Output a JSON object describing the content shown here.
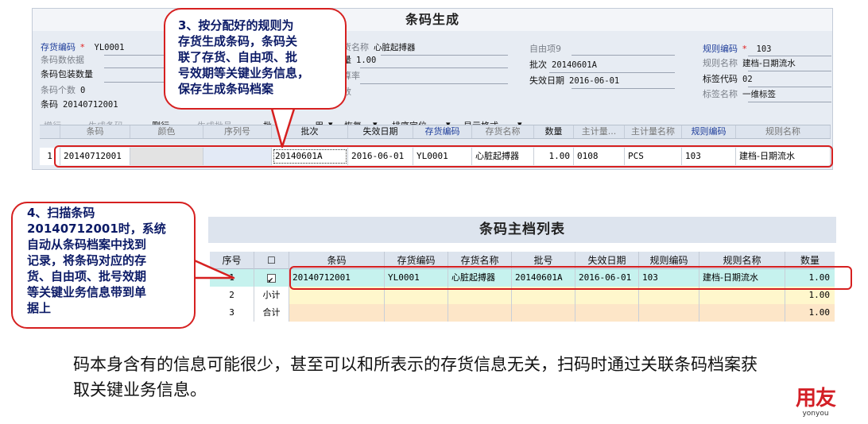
{
  "form": {
    "title": "条码生成",
    "fields": {
      "inv_code_label": "存货编码",
      "inv_code_value": "YL0001",
      "barcode_basis_label": "条码数依据",
      "package_qty_label": "条码包装数量",
      "barcode_count_label": "条码个数",
      "barcode_count_value": "0",
      "barcode_label": "条码",
      "barcode_value": "20140712001",
      "inv_name_label": "货名称",
      "inv_name_value": "心脏起搏器",
      "qty_label": "量",
      "qty_value": "1.00",
      "rate_label": "算率",
      "num_label": "数",
      "free9_label": "自由项9",
      "batch_label": "批次",
      "batch_value": "20140601A",
      "expire_label": "失效日期",
      "expire_value": "2016-06-01",
      "rule_code_label": "规则编码",
      "rule_code_value": "103",
      "rule_name_label": "规则名称",
      "rule_name_value": "建档-日期流水",
      "tag_code_label": "标签代码",
      "tag_code_value": "02",
      "tag_name_label": "标签名称",
      "tag_name_value": "一维标签",
      "required_mark": "*"
    },
    "toolbar": {
      "add": "增行",
      "generate_barcode": "生成条码",
      "delete": "删行",
      "generate_batch": "生成批号",
      "batch_partial": "批",
      "usage_partial": "用",
      "restore": "恢复",
      "sort_locate": "排序定位",
      "display_format": "显示格式",
      "dropdown": "▾"
    },
    "grid": {
      "headers": [
        "条码",
        "颜色",
        "序列号",
        "批次",
        "失效日期",
        "存货编码",
        "存货名称",
        "数量",
        "主计量...",
        "主计量名称",
        "规则编码",
        "规则名称"
      ],
      "row": {
        "index": "1",
        "cells": [
          "20140712001",
          "",
          "",
          "20140601A",
          "2016-06-01",
          "YL0001",
          "心脏起搏器",
          "1.00",
          "0108",
          "PCS",
          "103",
          "建档-日期流水"
        ]
      }
    }
  },
  "callout3": {
    "text": "3、按分配好的规则为\n存货生成条码，条码关\n联了存货、自由项、批\n号效期等关键业务信息，\n保存生成条码档案"
  },
  "callout4": {
    "text": "4、扫描条码\n20140712001时，系统\n自动从条码档案中找到\n记录，将条码对应的存\n货、自由项、批号效期\n等关键业务信息带到单\n据上"
  },
  "list": {
    "title": "条码主档列表",
    "headers": [
      "序号",
      "☐",
      "条码",
      "存货编码",
      "存货名称",
      "批号",
      "失效日期",
      "规则编码",
      "规则名称",
      "数量"
    ],
    "rows": [
      {
        "index": "1",
        "checked": true,
        "cells": [
          "20140712001",
          "YL0001",
          "心脏起搏器",
          "20140601A",
          "2016-06-01",
          "103",
          "建档-日期流水",
          "1.00"
        ]
      },
      {
        "index": "2",
        "label": "小计",
        "cells": [
          "",
          "",
          "",
          "",
          "",
          "",
          "",
          "1.00"
        ]
      },
      {
        "index": "3",
        "label": "合计",
        "cells": [
          "",
          "",
          "",
          "",
          "",
          "",
          "",
          "1.00"
        ]
      }
    ]
  },
  "note": "码本身含有的信息可能很少，甚至可以和所表示的存货信息无关，扫码时通过关联条码档案获取关键业务信息。",
  "logo": {
    "cn": "用友",
    "en": "yonyou"
  },
  "colors": {
    "accent": "#d62020",
    "row_highlight": "#c6f2ee",
    "subtotal_bg": "#fff7cc",
    "total_bg": "#fde6c8",
    "brand": "#d31f26"
  }
}
